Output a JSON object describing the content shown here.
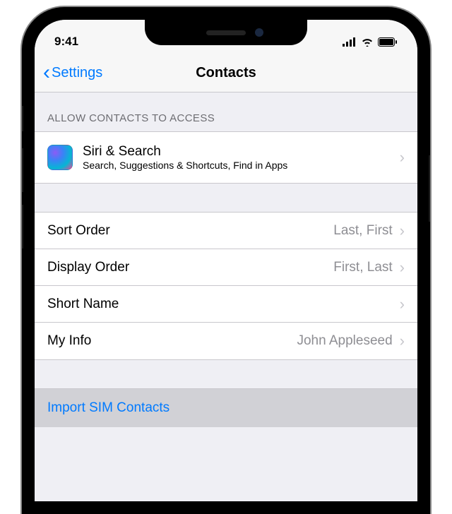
{
  "status": {
    "time": "9:41"
  },
  "nav": {
    "back_label": "Settings",
    "title": "Contacts"
  },
  "sections": {
    "access_header": "ALLOW CONTACTS TO ACCESS",
    "siri": {
      "title": "Siri & Search",
      "subtitle": "Search, Suggestions & Shortcuts, Find in Apps"
    },
    "settings": [
      {
        "label": "Sort Order",
        "value": "Last, First"
      },
      {
        "label": "Display Order",
        "value": "First, Last"
      },
      {
        "label": "Short Name",
        "value": ""
      },
      {
        "label": "My Info",
        "value": "John Appleseed"
      }
    ],
    "action": {
      "import_sim": "Import SIM Contacts"
    }
  }
}
